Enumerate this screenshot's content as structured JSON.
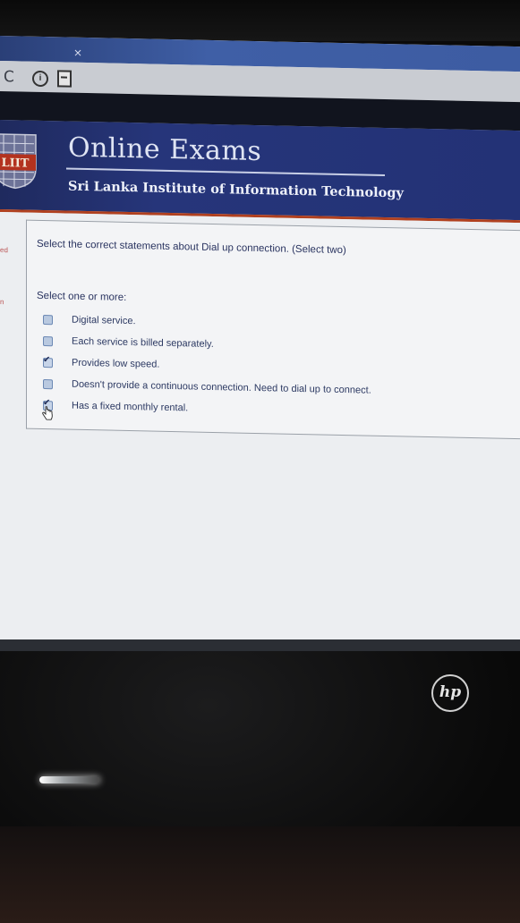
{
  "browser": {
    "tab_close": "×",
    "reload_icon": "C",
    "info_icon": "i"
  },
  "banner": {
    "logo_text": "LIIT",
    "title": "Online Exams",
    "subtitle": "Sri Lanka Institute of Information Technology"
  },
  "sidebar_fragments": [
    "ed",
    "n"
  ],
  "question": {
    "text": "Select the correct statements about Dial up connection. (Select two)",
    "prompt": "Select one or more:",
    "answers": [
      {
        "label": "Digital service.",
        "checked": false
      },
      {
        "label": "Each service is billed separately.",
        "checked": false
      },
      {
        "label": "Provides low speed.",
        "checked": true
      },
      {
        "label": "Doesn't provide a continuous connection. Need to dial up to connect.",
        "checked": false
      },
      {
        "label": "Has a fixed monthly rental.",
        "checked": true
      }
    ]
  },
  "device": {
    "brand": "hp"
  },
  "colors": {
    "banner": "#26357a",
    "accent_rule": "#b0401f",
    "text": "#2a3460"
  }
}
